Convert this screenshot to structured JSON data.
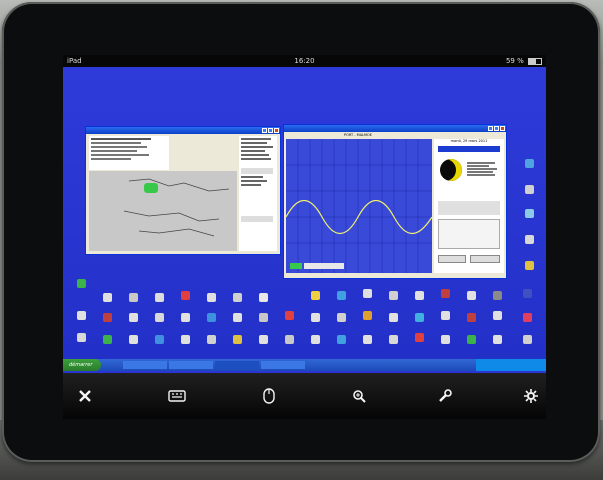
{
  "status_bar": {
    "device": "iPad",
    "time": "16:20",
    "battery": "59 %"
  },
  "toolbar": {
    "icons": [
      "close-icon",
      "keyboard-icon",
      "mouse-icon",
      "zoom-icon",
      "wrench-icon",
      "gear-icon"
    ]
  },
  "taskbar": {
    "start_label": "démarrer"
  },
  "windows": {
    "right": {
      "heading": "PORT - MALMOE",
      "date": "mardi, 29 mars 2011"
    }
  },
  "colors": {
    "desktop": "#2a35d4",
    "titlebar": "#0b3fc7",
    "toolbar": "#050505"
  }
}
